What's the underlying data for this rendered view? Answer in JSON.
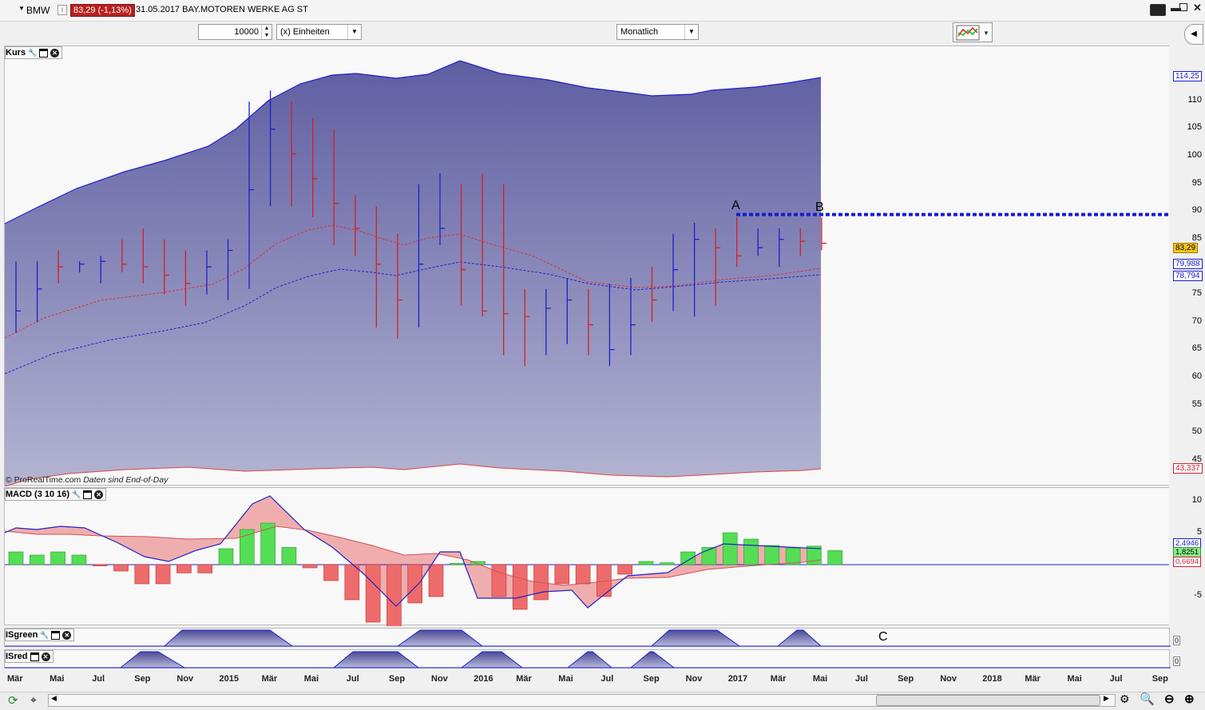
{
  "titlebar": {
    "symbol": "BMW",
    "info_icon": "i",
    "price_change": "83,29 (-1,13%)",
    "date_name": "31.05.2017 BAY.MOTOREN WERKE AG ST"
  },
  "toolbar": {
    "quantity_value": "10000",
    "units_select": "(x) Einheiten",
    "period_select": "Monatlich"
  },
  "panels": {
    "kurs": "Kurs",
    "macd": "MACD (3 10 16)",
    "isgreen": "ISgreen",
    "isred": "ISred"
  },
  "price_axis": {
    "ticks": [
      "110",
      "105",
      "100",
      "95",
      "90",
      "85",
      "75",
      "70",
      "65",
      "60",
      "55",
      "50",
      "45"
    ],
    "tag_upper": "114,25",
    "tag_last": "83,29",
    "tag_ma1": "79,988",
    "tag_ma2": "78,794",
    "tag_lower": "43,337"
  },
  "macd_axis": {
    "ticks": [
      "10",
      "5",
      "-5"
    ],
    "tag_macd": "2,4946",
    "tag_signal": "1,8251",
    "tag_hist": "0,6694"
  },
  "is_axis": {
    "isgreen_tick": "0",
    "isred_tick": "0"
  },
  "annotations": {
    "a": "A",
    "b": "B",
    "c": "C"
  },
  "credit": {
    "source": "© ProRealTime.com",
    "note": "Daten sind End-of-Day"
  },
  "x_axis": [
    "Mär",
    "Mai",
    "Jul",
    "Sep",
    "Nov",
    "2015",
    "Mär",
    "Mai",
    "Jul",
    "Sep",
    "Nov",
    "2016",
    "Mär",
    "Mai",
    "Jul",
    "Sep",
    "Nov",
    "2017",
    "Mär",
    "Mai",
    "Jul",
    "Sep",
    "Nov",
    "2018",
    "Mär",
    "Mai",
    "Jul",
    "Sep"
  ],
  "colors": {
    "up": "#1f1fcc",
    "down": "#d42020",
    "band_fill": "#6a6aa8",
    "macd_pos": "#55dd55",
    "macd_neg": "#ee6b6b",
    "resistance": "#1a1acc"
  },
  "chart_data": {
    "type": "bar",
    "title": "BMW",
    "period": "Monatlich",
    "ohlc_monthly_approx": [
      {
        "x": "2014-03",
        "low": 67,
        "high": 80,
        "close": 71,
        "dir": "up"
      },
      {
        "x": "2014-05",
        "low": 76,
        "high": 82,
        "close": 79,
        "dir": "down"
      },
      {
        "x": "2014-07",
        "low": 76,
        "high": 81,
        "close": 80,
        "dir": "up"
      },
      {
        "x": "2014-09",
        "low": 76,
        "high": 86,
        "close": 79,
        "dir": "down"
      },
      {
        "x": "2014-11",
        "low": 72,
        "high": 82,
        "close": 76,
        "dir": "down"
      },
      {
        "x": "2015-01",
        "low": 73,
        "high": 84,
        "close": 82,
        "dir": "up"
      },
      {
        "x": "2015-03",
        "low": 90,
        "high": 111,
        "close": 104,
        "dir": "up"
      },
      {
        "x": "2015-05",
        "low": 88,
        "high": 106,
        "close": 95,
        "dir": "down"
      },
      {
        "x": "2015-07",
        "low": 81,
        "high": 92,
        "close": 86,
        "dir": "down"
      },
      {
        "x": "2015-09",
        "low": 66,
        "high": 85,
        "close": 73,
        "dir": "down"
      },
      {
        "x": "2015-11",
        "low": 83,
        "high": 96,
        "close": 86,
        "dir": "up"
      },
      {
        "x": "2016-01",
        "low": 70,
        "high": 96,
        "close": 71,
        "dir": "down"
      },
      {
        "x": "2016-03",
        "low": 61,
        "high": 75,
        "close": 70,
        "dir": "down"
      },
      {
        "x": "2016-05",
        "low": 65,
        "high": 77,
        "close": 73,
        "dir": "up"
      },
      {
        "x": "2016-07",
        "low": 61,
        "high": 76,
        "close": 64,
        "dir": "up"
      },
      {
        "x": "2016-09",
        "low": 69,
        "high": 79,
        "close": 73,
        "dir": "down"
      },
      {
        "x": "2016-11",
        "low": 70,
        "high": 87,
        "close": 84,
        "dir": "up"
      },
      {
        "x": "2017-01",
        "low": 79,
        "high": 88,
        "close": 81,
        "dir": "down"
      },
      {
        "x": "2017-03",
        "low": 79,
        "high": 86,
        "close": 84,
        "dir": "up"
      },
      {
        "x": "2017-05",
        "low": 82,
        "high": 88,
        "close": 83.29,
        "dir": "down"
      }
    ],
    "resistance_level": 88.5,
    "ylim": [
      42,
      117
    ],
    "macd_hist_approx": [
      2,
      1.5,
      2,
      1.5,
      -0.2,
      -1,
      -3,
      -3,
      -1.3,
      -1.3,
      2.5,
      5.5,
      6.5,
      2.7,
      -0.5,
      -2.5,
      -5.5,
      -9,
      -10,
      -6,
      -5,
      0.2,
      0.5,
      -5,
      -7,
      -5.5,
      -3,
      -3,
      -5,
      -1.5,
      0.5,
      0.3,
      2,
      2.7,
      5,
      4,
      3,
      2.6,
      2.9,
      2.2
    ],
    "macd_ylim": [
      -11,
      12
    ]
  }
}
